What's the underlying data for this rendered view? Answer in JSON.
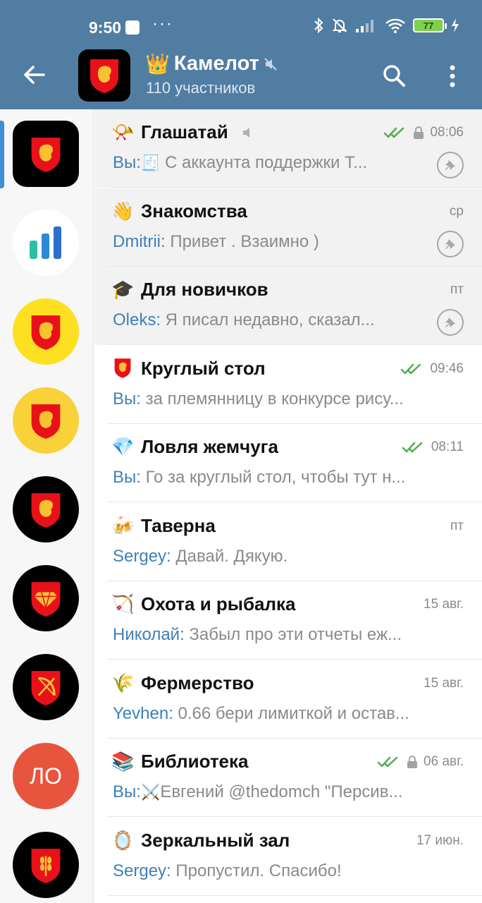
{
  "status_bar": {
    "time": "9:50",
    "dots": "···",
    "battery": "77"
  },
  "header": {
    "title_emoji": "👑",
    "title": "Камелот",
    "subtitle": "110 участников"
  },
  "colors": {
    "header": "#517da2",
    "sender": "#3f80b8",
    "check": "#4fae4e",
    "shield_red": "#e8111a",
    "yellow_avatar": "#fde021",
    "lo_avatar": "#e8553e"
  },
  "sidebar": {
    "items": [
      {
        "icon": "lion-shield-icon",
        "bg": "#000000",
        "shape": "sq"
      },
      {
        "icon": "bar-chart-icon",
        "bg": "#ffffff",
        "shape": "round"
      },
      {
        "icon": "lion-shield-icon",
        "bg": "#fde021",
        "shape": "round"
      },
      {
        "icon": "lion-shield-icon",
        "bg": "#f9d23a",
        "shape": "round"
      },
      {
        "icon": "lion-shield-icon",
        "bg": "#000000",
        "shape": "round"
      },
      {
        "icon": "diamond-shield-icon",
        "bg": "#000000",
        "shape": "round"
      },
      {
        "icon": "bow-shield-icon",
        "bg": "#000000",
        "shape": "round"
      },
      {
        "icon": "lo-text",
        "label": "ЛО",
        "bg": "#e8553e",
        "shape": "round"
      },
      {
        "icon": "wheat-shield-icon",
        "bg": "#000000",
        "shape": "round"
      }
    ]
  },
  "chats": [
    {
      "emoji": "📯",
      "name": "Глашатай",
      "muted": true,
      "checks": true,
      "locked": true,
      "time": "08:06",
      "sender": "Вы:",
      "inline_emoji": "🧾",
      "text": " С аккаунта поддержки Т...",
      "pinned": true
    },
    {
      "emoji": "👋",
      "name": "Знакомства",
      "time": "ср",
      "sender": "Dmitrii:",
      "text": " Привет . Взаимно )",
      "pinned": true
    },
    {
      "emoji": "🎓",
      "name": "Для новичков",
      "time": "пт",
      "sender": "Oleks:",
      "text": " Я писал недавно, сказал...",
      "pinned": true
    },
    {
      "emoji": "🛡",
      "name": "Круглый стол",
      "checks": true,
      "time": "09:46",
      "sender": "Вы:",
      "text": " за племянницу в конкурсе рису..."
    },
    {
      "emoji": "💎",
      "name": "Ловля жемчуга",
      "checks": true,
      "time": "08:11",
      "sender": "Вы:",
      "text": " Го за круглый стол, чтобы тут н..."
    },
    {
      "emoji": "🍻",
      "name": "Таверна",
      "time": "пт",
      "sender": "Sergey:",
      "text": " Давай. Дякую."
    },
    {
      "emoji": "🏹",
      "name": "Охота и рыбалка",
      "time": "15 авг.",
      "sender": "Николай:",
      "text": " Забыл про эти отчеты еж..."
    },
    {
      "emoji": "🌾",
      "name": "Фермерство",
      "time": "15 авг.",
      "sender": "Yevhen:",
      "text": " 0.66 бери лимиткой и остав..."
    },
    {
      "emoji": "📚",
      "name": "Библиотека",
      "checks": true,
      "locked": true,
      "time": "06 авг.",
      "sender": "Вы:",
      "inline_emoji": "⚔️",
      "text": "Евгений @thedomch \"Персив..."
    },
    {
      "emoji": "🪞",
      "name": "Зеркальный зал",
      "time": "17 июн.",
      "sender": "Sergey:",
      "text": " Пропустил. Спасибо!"
    }
  ]
}
